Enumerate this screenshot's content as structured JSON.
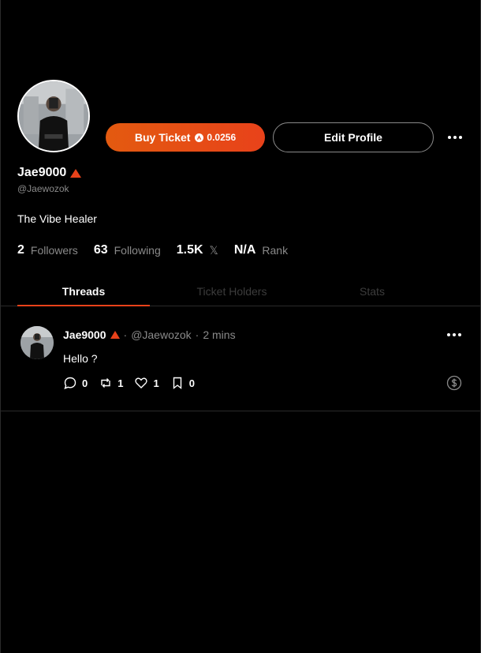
{
  "profile": {
    "display_name": "Jae9000",
    "handle": "@Jaewozok",
    "bio": "The Vibe Healer"
  },
  "buttons": {
    "buy_ticket_label": "Buy Ticket",
    "buy_ticket_price": "0.0256",
    "edit_profile_label": "Edit Profile"
  },
  "stats": {
    "followers_count": "2",
    "followers_label": "Followers",
    "following_count": "63",
    "following_label": "Following",
    "x_followers_count": "1.5K",
    "x_icon": "𝕏",
    "rank_value": "N/A",
    "rank_label": "Rank"
  },
  "tabs": [
    {
      "label": "Threads",
      "active": true
    },
    {
      "label": "Ticket Holders",
      "active": false
    },
    {
      "label": "Stats",
      "active": false
    }
  ],
  "post": {
    "author_name": "Jae9000",
    "author_handle": "@Jaewozok",
    "separator": "·",
    "time": "2 mins",
    "text": "Hello ?",
    "replies": "0",
    "reposts": "1",
    "likes": "1",
    "bookmarks": "0"
  },
  "colors": {
    "accent": "#e8421a",
    "background": "#000000",
    "muted_text": "#8a8a8a"
  },
  "icons": [
    "avax-icon",
    "more-icon",
    "x-logo-icon",
    "reply-icon",
    "repost-icon",
    "like-icon",
    "bookmark-icon",
    "tip-dollar-icon"
  ]
}
